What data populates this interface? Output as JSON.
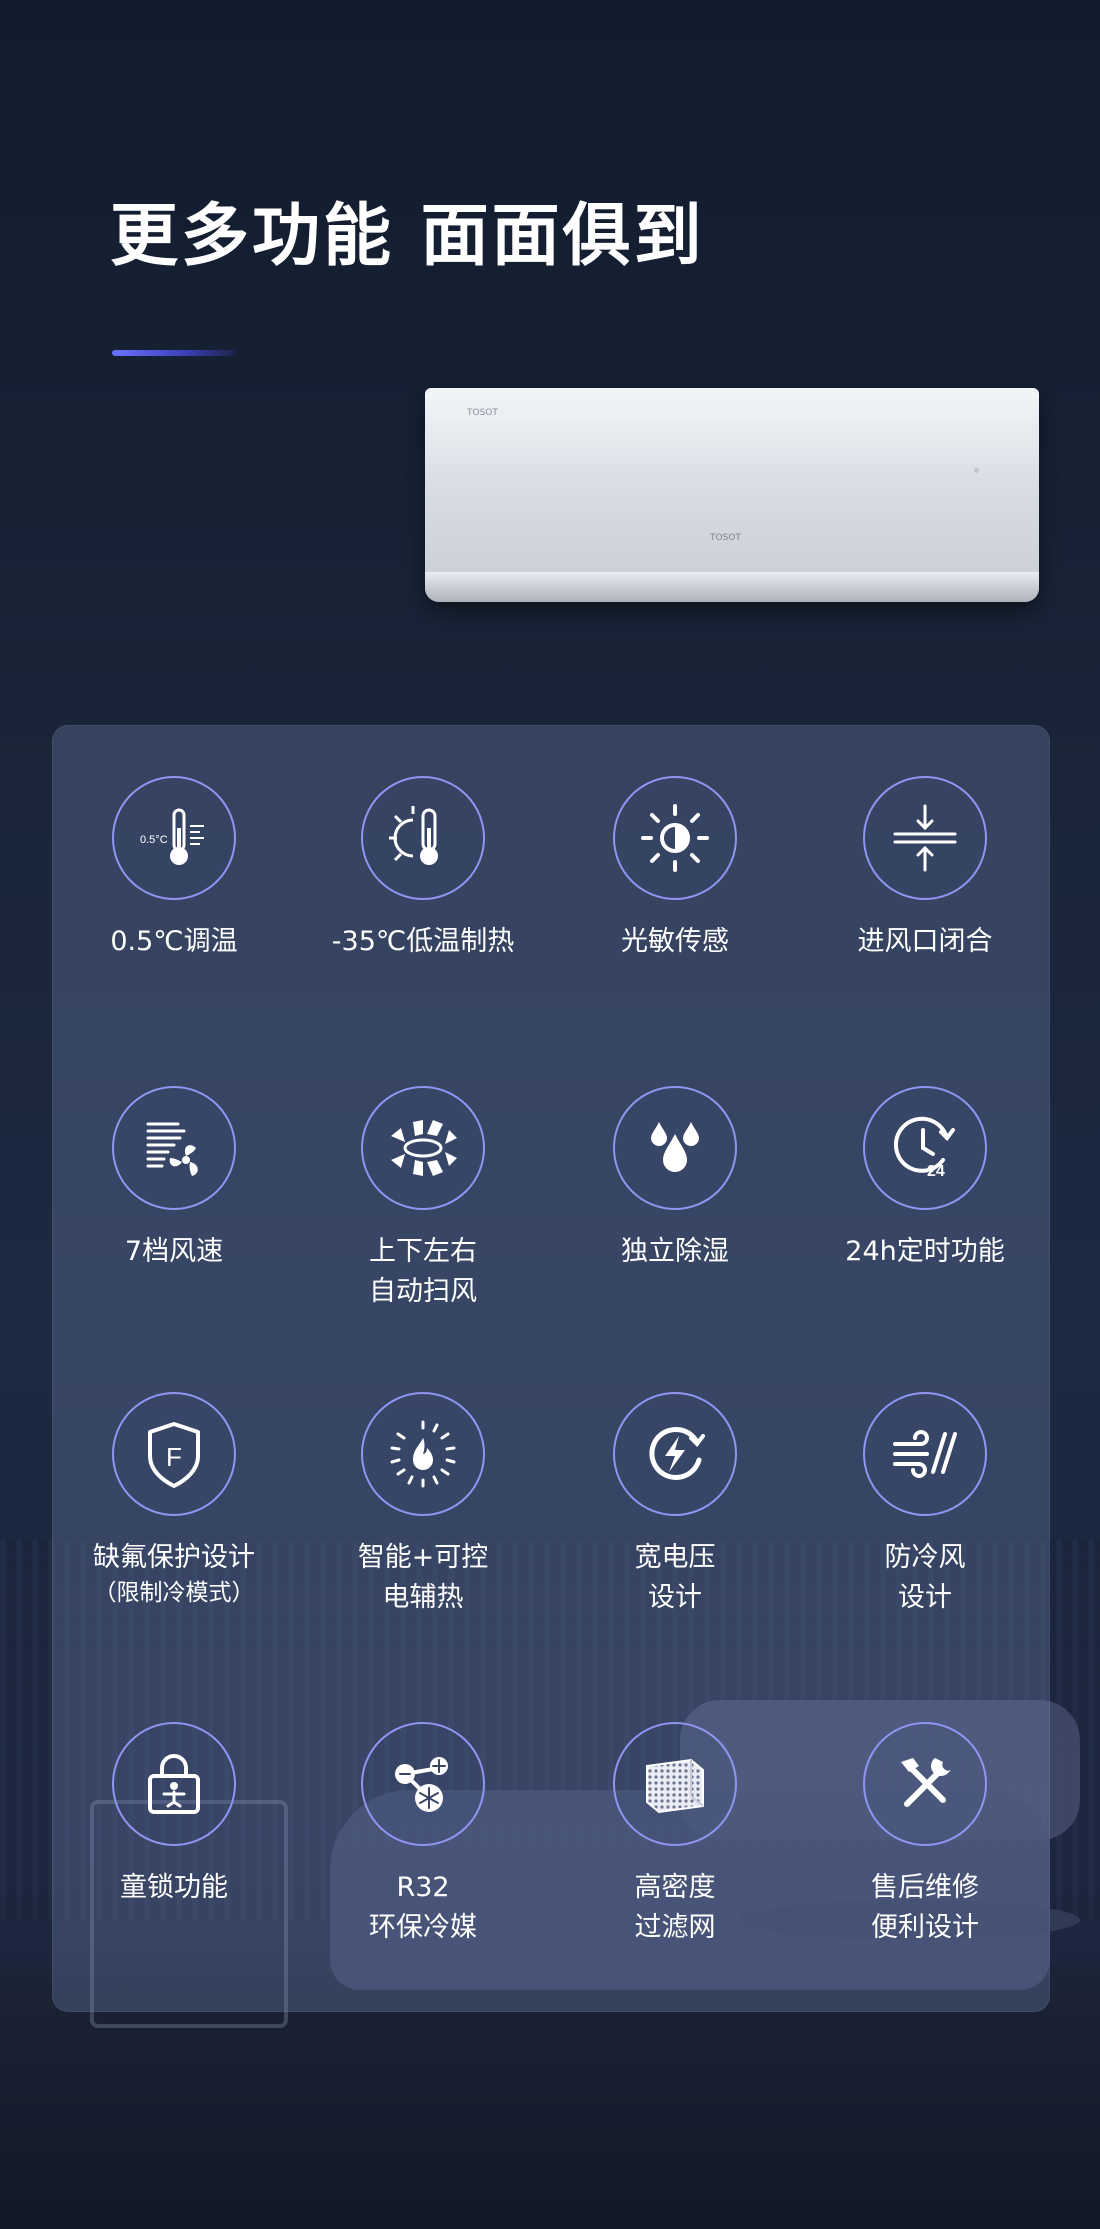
{
  "page": {
    "title": "更多功能 面面俱到"
  },
  "product": {
    "brand_top_left": "TOSOT",
    "brand_center": "TOSOT"
  },
  "features": [
    {
      "icon": "thermometer-icon",
      "icon_text": "0.5°C",
      "lines": [
        "0.5℃调温"
      ]
    },
    {
      "icon": "low-temp-heating-icon",
      "lines": [
        "-35℃低温制热"
      ]
    },
    {
      "icon": "light-sensor-icon",
      "lines": [
        "光敏传感"
      ]
    },
    {
      "icon": "air-inlet-close-icon",
      "lines": [
        "进风口闭合"
      ]
    },
    {
      "icon": "fan-speed-icon",
      "lines": [
        "7档风速"
      ]
    },
    {
      "icon": "swing-icon",
      "lines": [
        "上下左右",
        "自动扫风"
      ]
    },
    {
      "icon": "dehumidify-icon",
      "lines": [
        "独立除湿"
      ]
    },
    {
      "icon": "timer-icon",
      "icon_text": "24",
      "lines": [
        "24h定时功能"
      ]
    },
    {
      "icon": "refrigerant-shield-icon",
      "icon_text": "F",
      "lines": [
        "缺氟保护设计"
      ],
      "sub": "（限制冷模式）"
    },
    {
      "icon": "electric-heat-icon",
      "lines": [
        "智能+可控",
        "电辅热"
      ]
    },
    {
      "icon": "wide-voltage-icon",
      "lines": [
        "宽电压",
        "设计"
      ]
    },
    {
      "icon": "anti-cold-wind-icon",
      "lines": [
        "防冷风",
        "设计"
      ]
    },
    {
      "icon": "child-lock-icon",
      "lines": [
        "童锁功能"
      ]
    },
    {
      "icon": "r32-refrigerant-icon",
      "lines": [
        "R32",
        "环保冷媒"
      ]
    },
    {
      "icon": "filter-icon",
      "lines": [
        "高密度",
        "过滤网"
      ]
    },
    {
      "icon": "maintenance-tools-icon",
      "lines": [
        "售后维修",
        "便利设计"
      ]
    }
  ]
}
